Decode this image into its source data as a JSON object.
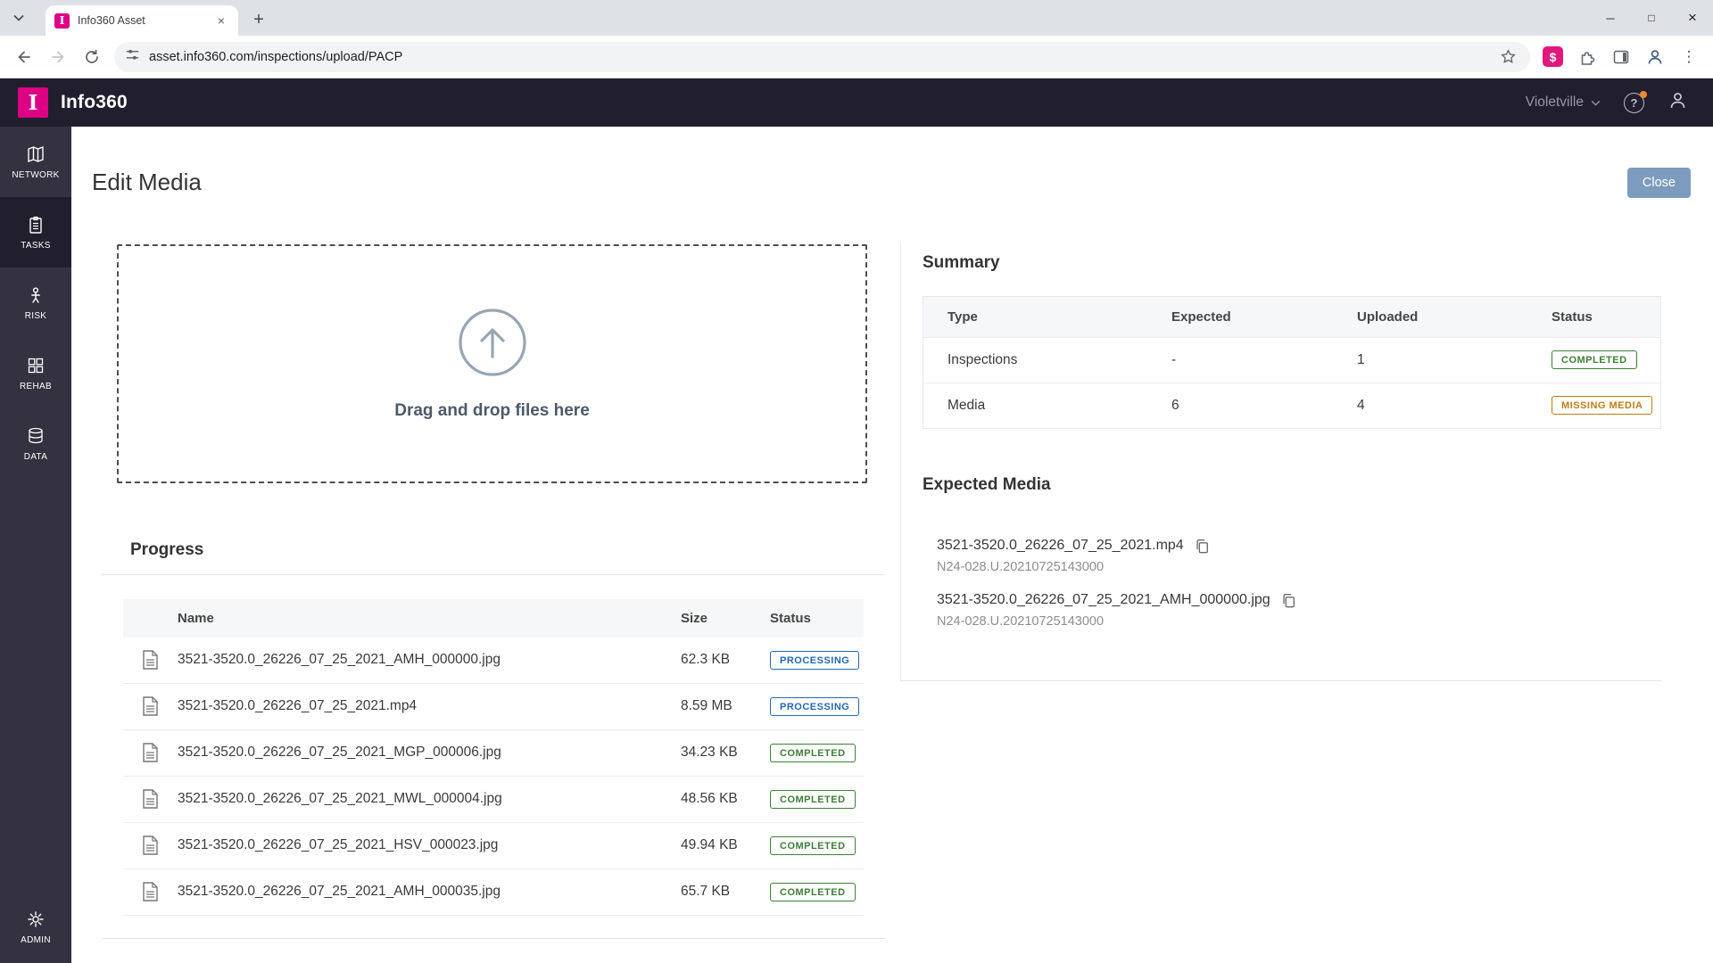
{
  "browser": {
    "tab_title": "Info360 Asset",
    "favicon_letter": "I",
    "url": "asset.info360.com/inspections/upload/PACP",
    "extension_badge": "$",
    "window_icons": {
      "minimize": "─",
      "maximize": "□",
      "close": "×"
    },
    "icons": {
      "menu_dots": "⋮",
      "new_tab": "+",
      "tab_close": "×"
    }
  },
  "app_header": {
    "logo_letter": "I",
    "app_name": "Info360",
    "workspace": "Violetville",
    "help_glyph": "?"
  },
  "sidebar": {
    "items": [
      {
        "label": "NETWORK"
      },
      {
        "label": "TASKS"
      },
      {
        "label": "RISK"
      },
      {
        "label": "REHAB"
      },
      {
        "label": "DATA"
      }
    ],
    "admin_label": "ADMIN"
  },
  "page": {
    "title": "Edit Media",
    "close_button": "Close"
  },
  "dropzone": {
    "label": "Drag and drop files here"
  },
  "progress": {
    "title": "Progress",
    "columns": [
      "Name",
      "Size",
      "Status"
    ],
    "rows": [
      {
        "name": "3521-3520.0_26226_07_25_2021_AMH_000000.jpg",
        "size": "62.3 KB",
        "status": "PROCESSING"
      },
      {
        "name": "3521-3520.0_26226_07_25_2021.mp4",
        "size": "8.59 MB",
        "status": "PROCESSING"
      },
      {
        "name": "3521-3520.0_26226_07_25_2021_MGP_000006.jpg",
        "size": "34.23 KB",
        "status": "COMPLETED"
      },
      {
        "name": "3521-3520.0_26226_07_25_2021_MWL_000004.jpg",
        "size": "48.56 KB",
        "status": "COMPLETED"
      },
      {
        "name": "3521-3520.0_26226_07_25_2021_HSV_000023.jpg",
        "size": "49.94 KB",
        "status": "COMPLETED"
      },
      {
        "name": "3521-3520.0_26226_07_25_2021_AMH_000035.jpg",
        "size": "65.7 KB",
        "status": "COMPLETED"
      }
    ]
  },
  "summary": {
    "title": "Summary",
    "columns": [
      "Type",
      "Expected",
      "Uploaded",
      "Status"
    ],
    "rows": [
      {
        "type": "Inspections",
        "expected": "-",
        "uploaded": "1",
        "status": "COMPLETED"
      },
      {
        "type": "Media",
        "expected": "6",
        "uploaded": "4",
        "status": "MISSING MEDIA"
      }
    ]
  },
  "expected_media": {
    "title": "Expected Media",
    "items": [
      {
        "name": "3521-3520.0_26226_07_25_2021.mp4",
        "id": "N24-028.U.20210725143000"
      },
      {
        "name": "3521-3520.0_26226_07_25_2021_AMH_000000.jpg",
        "id": "N24-028.U.20210725143000"
      }
    ]
  },
  "colors": {
    "brand_pink": "#dd0085",
    "header_bg": "#211f2e",
    "sidebar_bg": "#343140",
    "status_processing": "#2468b5",
    "status_completed": "#3e7f36",
    "status_missing_media": "#bd7d15",
    "close_button_bg": "#7d9cbd"
  }
}
